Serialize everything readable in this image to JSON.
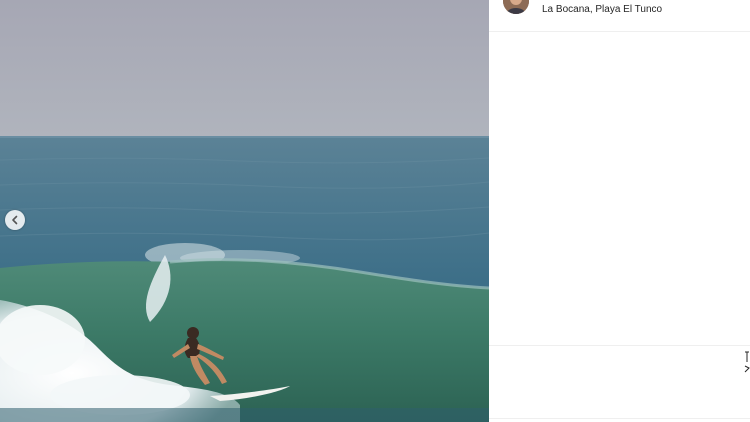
{
  "post": {
    "location": "La Bocana, Playa El Tunco",
    "photo_description": "surfer-riding-wave"
  },
  "icons": {
    "prev": "chevron-left-icon",
    "more": "more-options-icon",
    "edge": "share-icon"
  },
  "glyphs": {
    "more": "···"
  },
  "colors": {
    "sky": "#a7a9b5",
    "ocean": "#3c6e86",
    "wave": "#3e7c67",
    "foam": "#f4f6f7",
    "panel_bg": "#ffffff",
    "text": "#262626"
  }
}
